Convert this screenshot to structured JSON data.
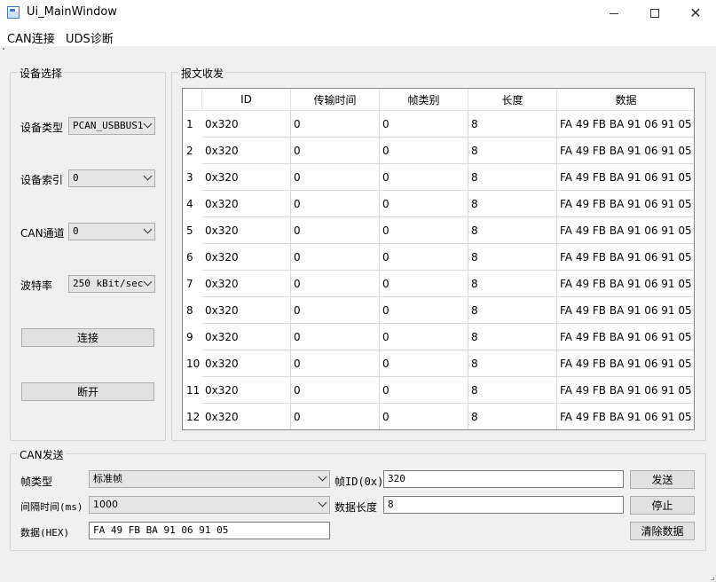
{
  "window": {
    "title": "Ui_MainWindow"
  },
  "menu": {
    "can": "CAN连接",
    "uds": "UDS诊断"
  },
  "device": {
    "group_title": "设备选择",
    "type_label": "设备类型",
    "type_value": "PCAN_USBBUS1",
    "index_label": "设备索引",
    "index_value": "0",
    "channel_label": "CAN通道",
    "channel_value": "0",
    "baud_label": "波特率",
    "baud_value": "250 kBit/sec",
    "connect": "连接",
    "disconnect": "断开"
  },
  "messages": {
    "group_title": "报文收发",
    "columns": [
      "ID",
      "传输时间",
      "帧类别",
      "长度",
      "数据"
    ],
    "rows": [
      {
        "n": "1",
        "id": "0x320",
        "time": "0",
        "type": "0",
        "len": "8",
        "data": "FA 49 FB BA 91 06 91 05"
      },
      {
        "n": "2",
        "id": "0x320",
        "time": "0",
        "type": "0",
        "len": "8",
        "data": "FA 49 FB BA 91 06 91 05"
      },
      {
        "n": "3",
        "id": "0x320",
        "time": "0",
        "type": "0",
        "len": "8",
        "data": "FA 49 FB BA 91 06 91 05"
      },
      {
        "n": "4",
        "id": "0x320",
        "time": "0",
        "type": "0",
        "len": "8",
        "data": "FA 49 FB BA 91 06 91 05"
      },
      {
        "n": "5",
        "id": "0x320",
        "time": "0",
        "type": "0",
        "len": "8",
        "data": "FA 49 FB BA 91 06 91 05"
      },
      {
        "n": "6",
        "id": "0x320",
        "time": "0",
        "type": "0",
        "len": "8",
        "data": "FA 49 FB BA 91 06 91 05"
      },
      {
        "n": "7",
        "id": "0x320",
        "time": "0",
        "type": "0",
        "len": "8",
        "data": "FA 49 FB BA 91 06 91 05"
      },
      {
        "n": "8",
        "id": "0x320",
        "time": "0",
        "type": "0",
        "len": "8",
        "data": "FA 49 FB BA 91 06 91 05"
      },
      {
        "n": "9",
        "id": "0x320",
        "time": "0",
        "type": "0",
        "len": "8",
        "data": "FA 49 FB BA 91 06 91 05"
      },
      {
        "n": "10",
        "id": "0x320",
        "time": "0",
        "type": "0",
        "len": "8",
        "data": "FA 49 FB BA 91 06 91 05"
      },
      {
        "n": "11",
        "id": "0x320",
        "time": "0",
        "type": "0",
        "len": "8",
        "data": "FA 49 FB BA 91 06 91 05"
      },
      {
        "n": "12",
        "id": "0x320",
        "time": "0",
        "type": "0",
        "len": "8",
        "data": "FA 49 FB BA 91 06 91 05"
      }
    ]
  },
  "send": {
    "group_title": "CAN发送",
    "frame_type_label": "帧类型",
    "frame_type_value": "标准帧",
    "frame_id_label": "帧ID(0x)",
    "frame_id_value": "320",
    "send_button": "发送",
    "interval_label": "间隔时间(ms)",
    "interval_value": "1000",
    "data_len_label": "数据长度",
    "data_len_value": "8",
    "stop_button": "停止",
    "data_label": "数据(HEX)",
    "data_value": "FA 49 FB BA 91 06 91 05",
    "clear_button": "清除数据"
  }
}
